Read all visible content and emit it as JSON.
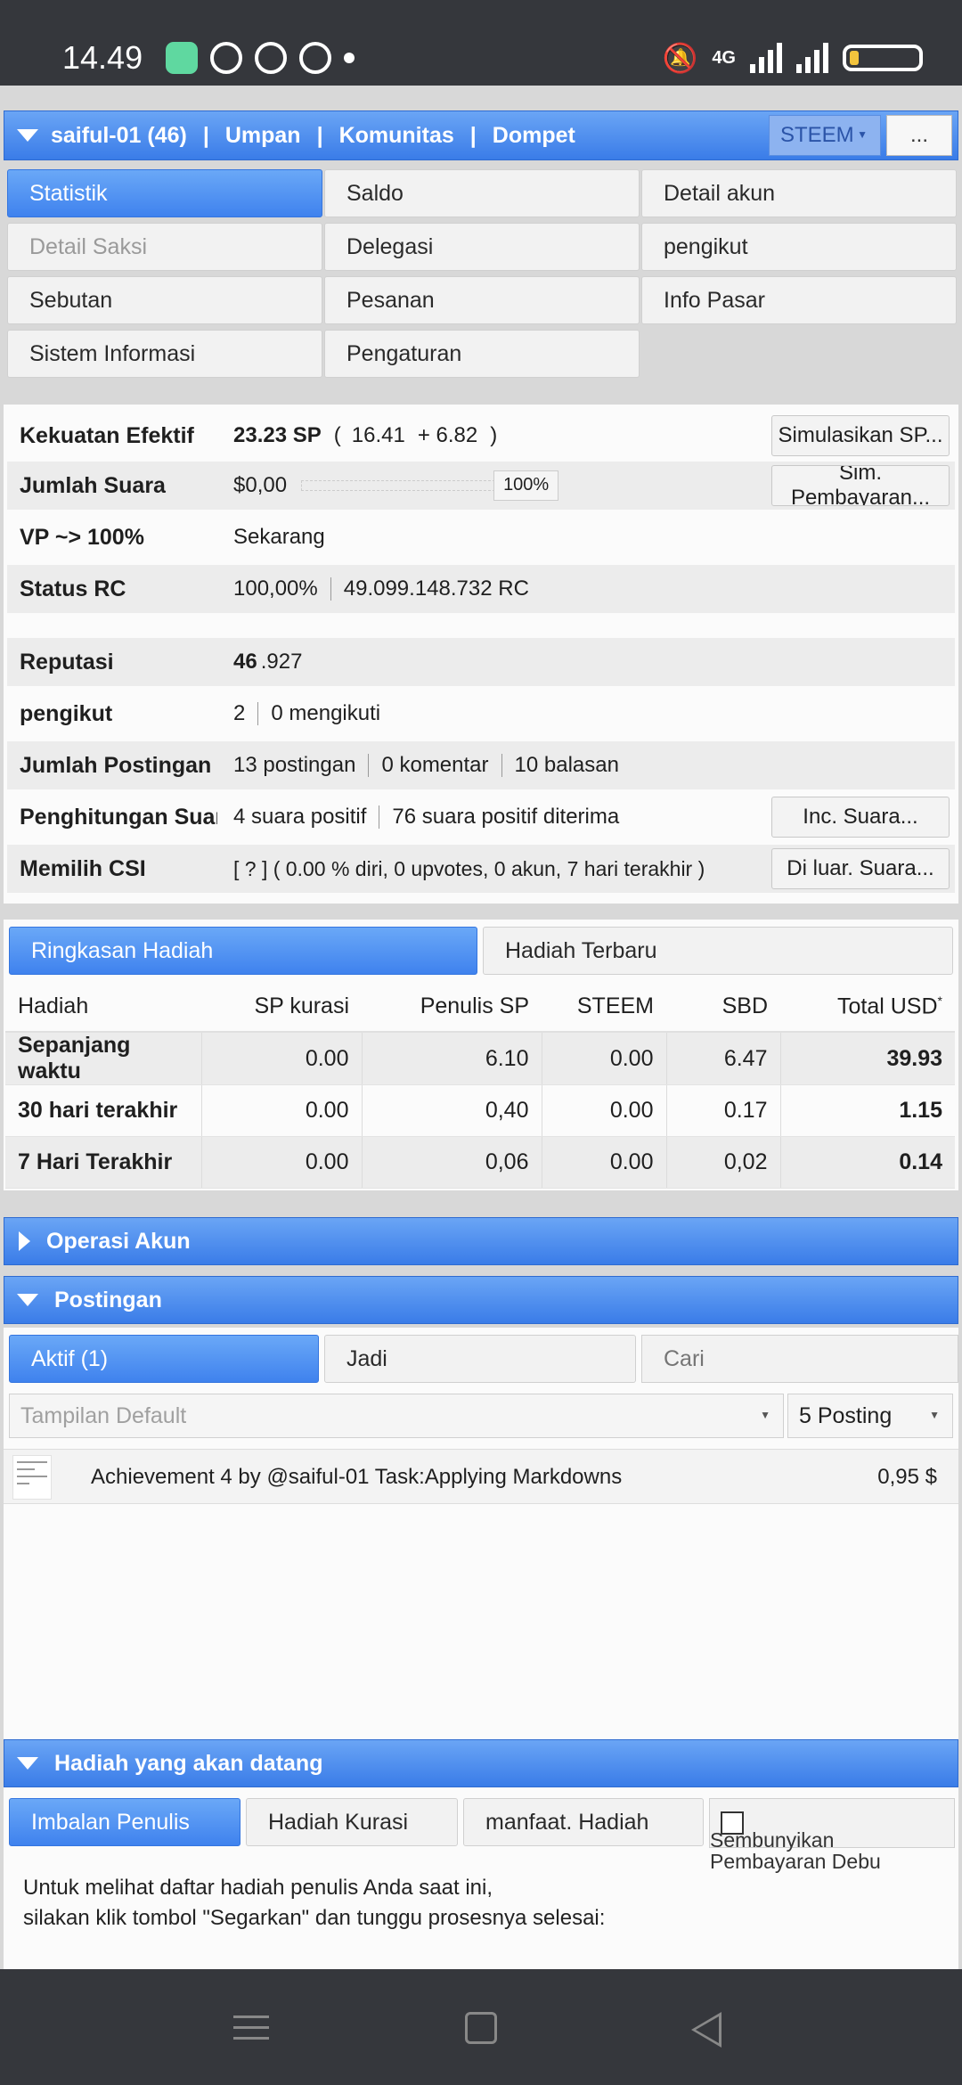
{
  "status_bar": {
    "time": "14.49",
    "network": "4G"
  },
  "topbar": {
    "account": "saiful-01 (46)",
    "nav": [
      "Umpan",
      "Komunitas",
      "Dompet"
    ],
    "currency": "STEEM",
    "more": "..."
  },
  "tabs": {
    "statistik": "Statistik",
    "saldo": "Saldo",
    "detail_akun": "Detail akun",
    "detail_saksi": "Detail Saksi",
    "delegasi": "Delegasi",
    "pengikut": "pengikut",
    "sebutan": "Sebutan",
    "pesanan": "Pesanan",
    "info_pasar": "Info Pasar",
    "sistem_informasi": "Sistem Informasi",
    "pengaturan": "Pengaturan"
  },
  "stats": {
    "kekuatan": {
      "label": "Kekuatan Efektif",
      "sp": "23.23 SP",
      "open": "(",
      "own": "16.41",
      "delegated": "+ 6.82",
      "close": ")",
      "button": "Simulasikan SP..."
    },
    "suara": {
      "label": "Jumlah Suara",
      "value": "$0,00",
      "pct": "100%",
      "button": "Sim. Pembayaran..."
    },
    "vp": {
      "label": "VP ~> 100%",
      "value": "Sekarang"
    },
    "rc": {
      "label": "Status RC",
      "pct": "100,00%",
      "value": "49.099.148.732 RC"
    },
    "reputasi": {
      "label": "Reputasi",
      "main": "46",
      "decimal": ".927"
    },
    "pengikut": {
      "label": "pengikut",
      "followers": "2",
      "following": "0 mengikuti"
    },
    "postingan": {
      "label": "Jumlah Postingan",
      "posts": "13 postingan",
      "comments": "0 komentar",
      "replies": "10 balasan"
    },
    "hitung": {
      "label": "Penghitungan Suara",
      "positive": "4 suara positif",
      "received": "76 suara positif diterima",
      "button": "Inc. Suara..."
    },
    "csi": {
      "label": "Memilih CSI",
      "value": "[ ? ] ( 0.00 % diri, 0 upvotes, 0 akun, 7 hari terakhir )",
      "button": "Di luar. Suara..."
    }
  },
  "rewards": {
    "tab_summary": "Ringkasan Hadiah",
    "tab_recent": "Hadiah Terbaru",
    "headers": [
      "Hadiah",
      "SP kurasi",
      "Penulis SP",
      "STEEM",
      "SBD",
      "Total USD"
    ],
    "header_note": "*",
    "rows": [
      [
        "Sepanjang waktu",
        "0.00",
        "6.10",
        "0.00",
        "6.47",
        "39.93"
      ],
      [
        "30 hari terakhir",
        "0.00",
        "0,40",
        "0.00",
        "0.17",
        "1.15"
      ],
      [
        "7 Hari Terakhir",
        "0.00",
        "0,06",
        "0.00",
        "0,02",
        "0.14"
      ]
    ]
  },
  "operasi": {
    "title": "Operasi Akun"
  },
  "postingan": {
    "title": "Postingan",
    "tab_active": "Aktif (1)",
    "tab_done": "Jadi",
    "search_placeholder": "Cari",
    "view_select": "Tampilan Default",
    "count_select": "5 Posting",
    "items": [
      {
        "title": "Achievement 4 by @saiful-01 Task:Applying Markdowns",
        "amount": "0,95 $"
      }
    ]
  },
  "upcoming": {
    "title": "Hadiah yang akan datang",
    "tab_author": "Imbalan Penulis",
    "tab_curation": "Hadiah Kurasi",
    "tab_benefit": "manfaat. Hadiah",
    "hide_dust": "Sembunyikan Pembayaran Debu",
    "info_line1": "Untuk melihat daftar hadiah penulis Anda saat ini,",
    "info_line2": "silakan klik tombol \"Segarkan\" dan tunggu prosesnya selesai:"
  },
  "colors": {
    "accent": "#3a7ce8",
    "status_bar": "#35373c"
  }
}
